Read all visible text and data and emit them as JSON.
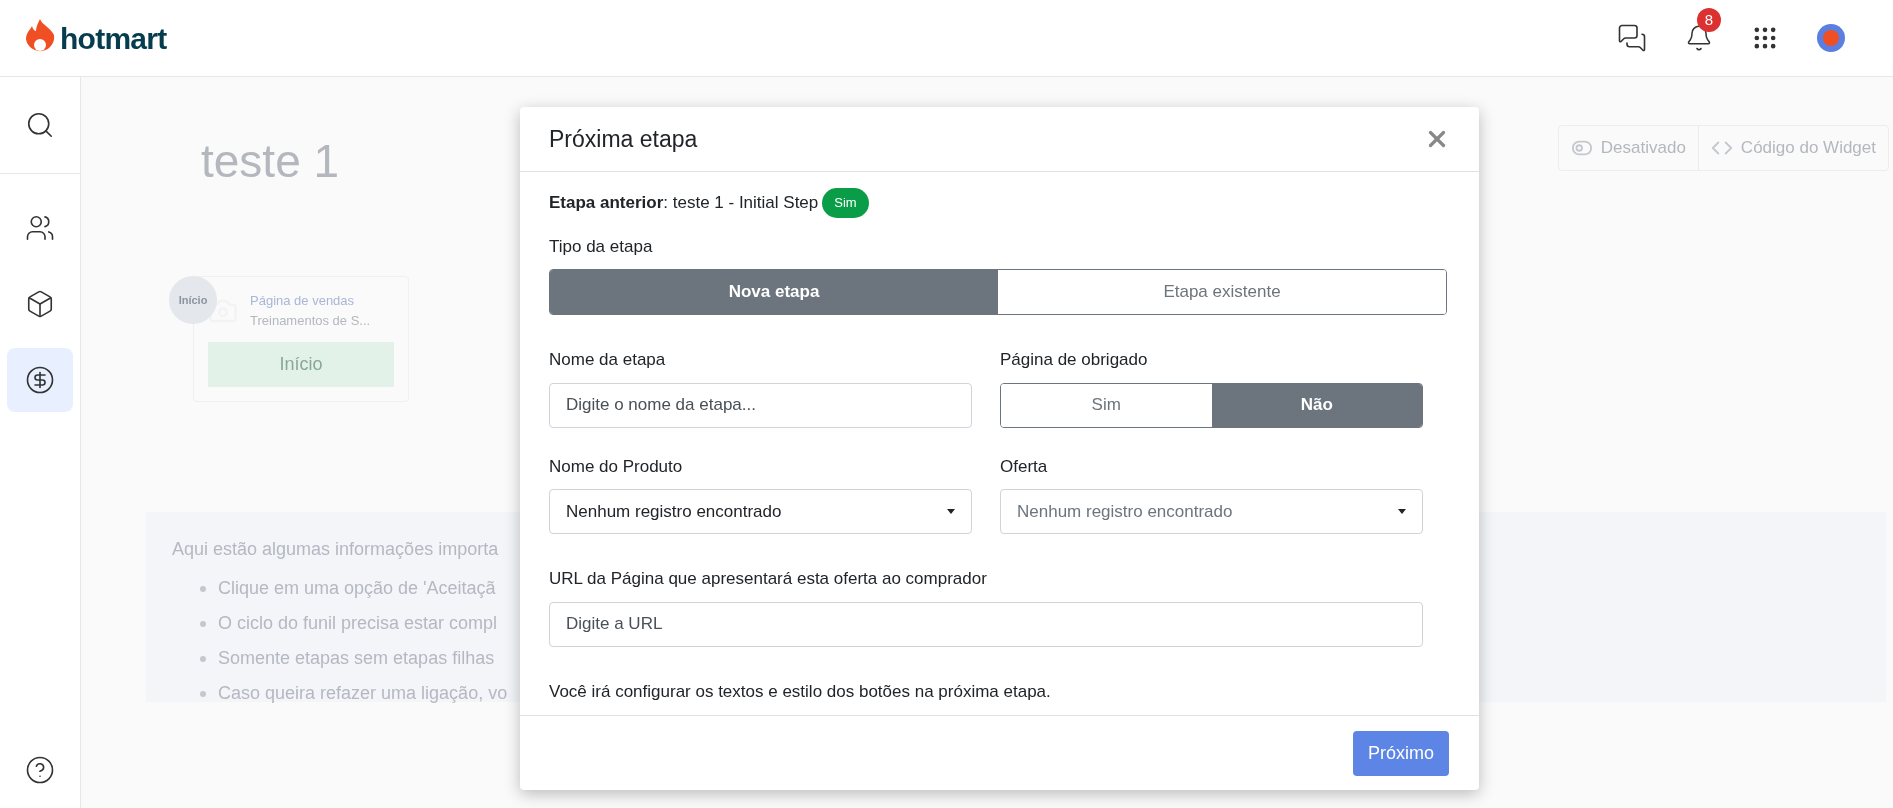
{
  "header": {
    "logo": "hotmart",
    "notifications": "8"
  },
  "sidebar": {
    "items": [
      {
        "kind": "search",
        "selected": false
      },
      {
        "kind": "users",
        "selected": false
      },
      {
        "kind": "box",
        "selected": false
      },
      {
        "kind": "dollar",
        "selected": true
      },
      {
        "kind": "help",
        "selected": false
      }
    ]
  },
  "background": {
    "title": "teste 1",
    "actions": [
      {
        "kind": "toggle",
        "label": "Desativado"
      },
      {
        "kind": "code",
        "label": "Código do Widget"
      }
    ],
    "node": {
      "badge": "Início",
      "title": "Página de vendas",
      "subtitle": "Treinamentos de S...",
      "button": "Início"
    },
    "info": {
      "intro": "Aqui estão algumas informações importa",
      "bullets": [
        "Clique em uma opção de 'Aceitaçã",
        "O ciclo do funil precisa estar compl",
        "Somente etapas sem etapas filhas",
        "Caso queira refazer uma ligação, vo"
      ]
    }
  },
  "modal": {
    "title": "Próxima etapa",
    "previous": "**Etapa anterior**: teste 1 - Initial Step",
    "previous_badge": "Sim",
    "step_type": {
      "label": "Tipo da etapa",
      "options": [
        {
          "label": "Nova etapa",
          "selected": true
        },
        {
          "label": "Etapa existente",
          "selected": false
        }
      ]
    },
    "step_name": {
      "label": "Nome da etapa",
      "placeholder": "Digite o nome da etapa..."
    },
    "thank_you": {
      "label": "Página de obrigado",
      "options": [
        {
          "label": "Sim",
          "selected": false
        },
        {
          "label": "Não",
          "selected": true
        }
      ]
    },
    "product": {
      "label": "Nome do Produto",
      "value": "Nenhum registro encontrado",
      "disabled": false
    },
    "offer": {
      "label": "Oferta",
      "value": "Nenhum registro encontrado",
      "disabled": true
    },
    "url": {
      "label": "URL da Página que apresentará esta oferta ao comprador",
      "placeholder": "Digite a URL"
    },
    "note": "Você irá configurar os textos e estilo dos botões na próxima etapa.",
    "next_button": "Próximo"
  }
}
